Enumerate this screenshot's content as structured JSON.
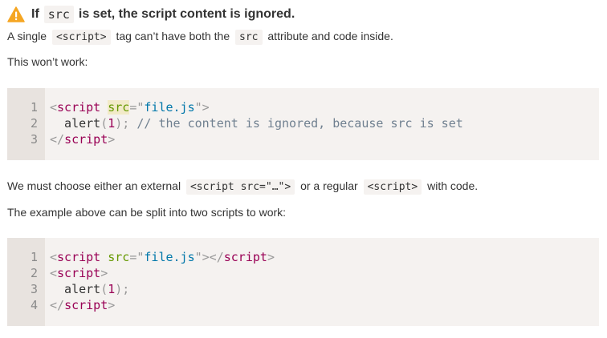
{
  "warning": {
    "icon": "warning-icon",
    "icon_color": "#f5a623",
    "title_prefix": "If",
    "title_code": "src",
    "title_suffix": "is set, the script content is ignored."
  },
  "para1": {
    "before": "A single",
    "code": "<script>",
    "middle": "tag can’t have both the",
    "code2": "src",
    "after": "attribute and code inside."
  },
  "para2": {
    "text": "This won’t work:"
  },
  "code_block_1": {
    "lines": [
      {
        "num": "1",
        "tokens": [
          {
            "t": "punct",
            "v": "<"
          },
          {
            "t": "tag",
            "v": "script"
          },
          {
            "t": "plain",
            "v": " "
          },
          {
            "t": "attr-hl",
            "v": "src"
          },
          {
            "t": "punct",
            "v": "=\""
          },
          {
            "t": "str",
            "v": "file.js"
          },
          {
            "t": "punct",
            "v": "\">"
          }
        ]
      },
      {
        "num": "2",
        "tokens": [
          {
            "t": "plain",
            "v": "  alert"
          },
          {
            "t": "punct",
            "v": "("
          },
          {
            "t": "num",
            "v": "1"
          },
          {
            "t": "punct",
            "v": ");"
          },
          {
            "t": "plain",
            "v": " "
          },
          {
            "t": "comment",
            "v": "// the content is ignored, because src is set"
          }
        ]
      },
      {
        "num": "3",
        "tokens": [
          {
            "t": "punct",
            "v": "</"
          },
          {
            "t": "tag",
            "v": "script"
          },
          {
            "t": "punct",
            "v": ">"
          }
        ]
      }
    ]
  },
  "para3": {
    "before": "We must choose either an external",
    "code": "<script src=\"…\">",
    "middle": "or a regular",
    "code2": "<script>",
    "after": "with code."
  },
  "para4": {
    "text": "The example above can be split into two scripts to work:"
  },
  "code_block_2": {
    "lines": [
      {
        "num": "1",
        "tokens": [
          {
            "t": "punct",
            "v": "<"
          },
          {
            "t": "tag",
            "v": "script"
          },
          {
            "t": "plain",
            "v": " "
          },
          {
            "t": "attr",
            "v": "src"
          },
          {
            "t": "punct",
            "v": "=\""
          },
          {
            "t": "str",
            "v": "file.js"
          },
          {
            "t": "punct",
            "v": "\"></"
          },
          {
            "t": "tag",
            "v": "script"
          },
          {
            "t": "punct",
            "v": ">"
          }
        ]
      },
      {
        "num": "2",
        "tokens": [
          {
            "t": "punct",
            "v": "<"
          },
          {
            "t": "tag",
            "v": "script"
          },
          {
            "t": "punct",
            "v": ">"
          }
        ]
      },
      {
        "num": "3",
        "tokens": [
          {
            "t": "plain",
            "v": "  alert"
          },
          {
            "t": "punct",
            "v": "("
          },
          {
            "t": "num",
            "v": "1"
          },
          {
            "t": "punct",
            "v": ");"
          }
        ]
      },
      {
        "num": "4",
        "tokens": [
          {
            "t": "punct",
            "v": "</"
          },
          {
            "t": "tag",
            "v": "script"
          },
          {
            "t": "punct",
            "v": ">"
          }
        ]
      }
    ]
  }
}
